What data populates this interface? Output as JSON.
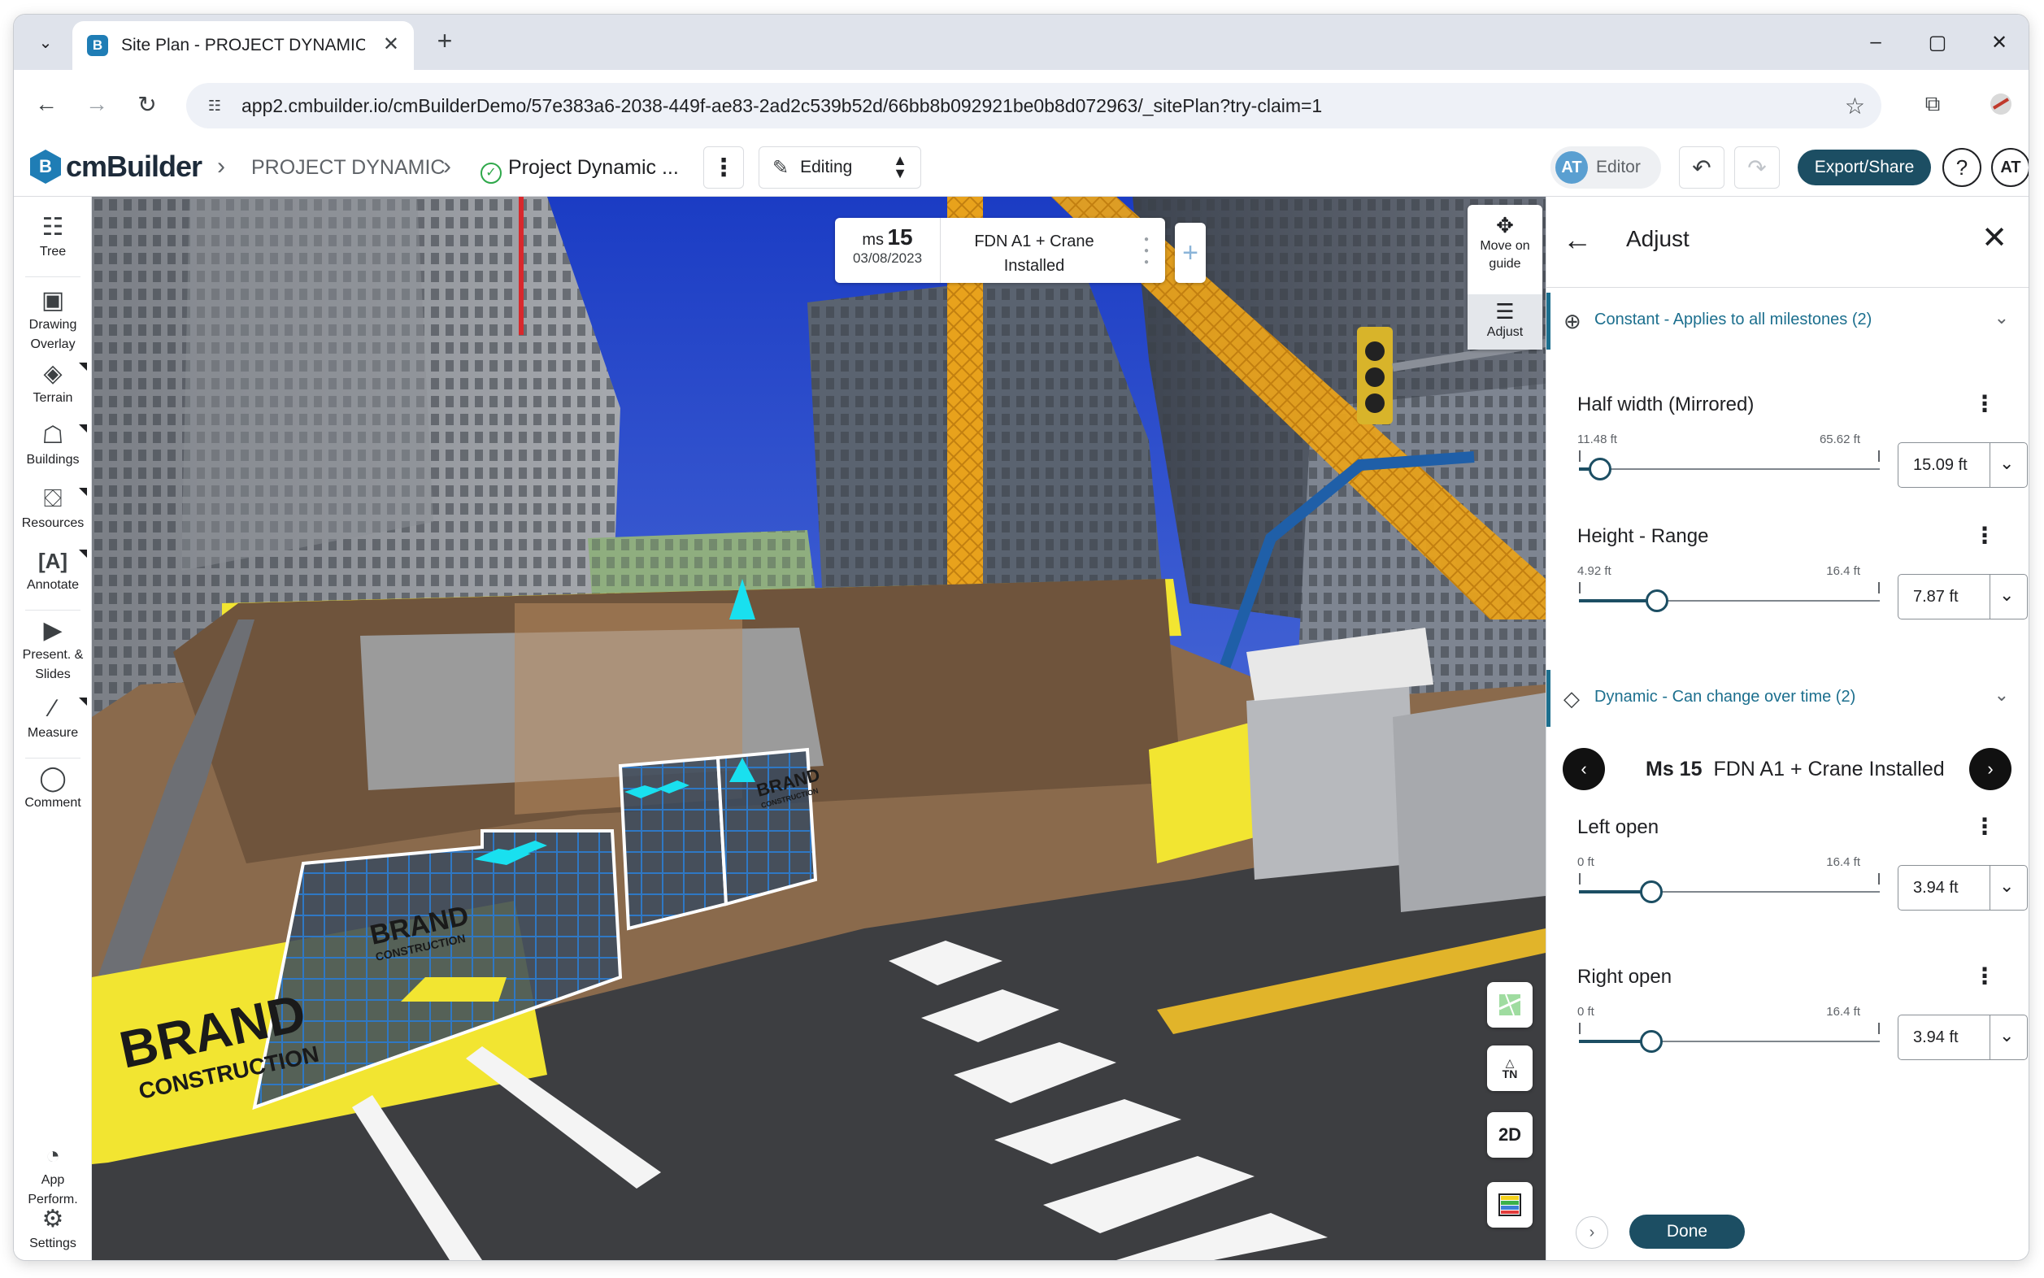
{
  "browser": {
    "tab_title": "Site Plan - PROJECT DYNAMIC",
    "favicon_letter": "B",
    "url": "app2.cmbuilder.io/cmBuilderDemo/57e383a6-2038-449f-ae83-2ad2c539b52d/66bb8b092921be0b8d072963/_sitePlan?try-claim=1"
  },
  "header": {
    "logo_mark": "B",
    "logo_text": "cmBuilder",
    "breadcrumb_project": "PROJECT DYNAMIC",
    "breadcrumb_plan": "Project Dynamic ...",
    "mode": "Editing",
    "role_initials": "AT",
    "role_label": "Editor",
    "export_label": "Export/Share",
    "help_label": "?",
    "user_initials": "AT"
  },
  "left_tools": [
    {
      "label": "Tree",
      "icon": "tree-icon"
    },
    {
      "label": "Drawing Overlay",
      "icon": "image-icon"
    },
    {
      "label": "Terrain",
      "icon": "terrain-icon"
    },
    {
      "label": "Buildings",
      "icon": "building-icon"
    },
    {
      "label": "Resources",
      "icon": "resources-icon"
    },
    {
      "label": "Annotate",
      "icon": "annotate-icon"
    },
    {
      "label": "Present. & Slides",
      "icon": "presentation-icon"
    },
    {
      "label": "Measure",
      "icon": "ruler-icon"
    },
    {
      "label": "Comment",
      "icon": "comment-icon"
    },
    {
      "label": "App Perform.",
      "icon": "performance-icon"
    },
    {
      "label": "Settings",
      "icon": "settings-icon"
    }
  ],
  "milestone_card": {
    "prefix": "ms",
    "number": "15",
    "date": "03/08/2023",
    "name_line1": "FDN A1 + Crane",
    "name_line2": "Installed",
    "add_label": "+"
  },
  "view_tools": {
    "move_label": "Move on guide",
    "adjust_label": "Adjust"
  },
  "map_buttons": {
    "north_label": "TN",
    "view_2d_label": "2D"
  },
  "panel": {
    "title": "Adjust",
    "constant_section": "Constant - Applies to all milestones (2)",
    "dynamic_section": "Dynamic - Can change over time (2)",
    "properties_constant": [
      {
        "label": "Half width (Mirrored)",
        "min": "11.48 ft",
        "max": "65.62 ft",
        "value": "15.09 ft",
        "fraction": 0.07
      },
      {
        "label": "Height - Range",
        "min": "4.92 ft",
        "max": "16.4 ft",
        "value": "7.87 ft",
        "fraction": 0.26
      }
    ],
    "milestone_nav": {
      "prefix": "Ms 15",
      "name": "FDN A1 + Crane Installed"
    },
    "properties_dynamic": [
      {
        "label": "Left open",
        "min": "0 ft",
        "max": "16.4 ft",
        "value": "3.94 ft",
        "fraction": 0.24
      },
      {
        "label": "Right open",
        "min": "0 ft",
        "max": "16.4 ft",
        "value": "3.94 ft",
        "fraction": 0.24
      }
    ],
    "done_label": "Done"
  },
  "scene_text": {
    "billboard_line1": "BRAND",
    "billboard_line2": "CONSTRUCTION",
    "gate_line1": "BRAND",
    "gate_line2": "CONSTRUCTION",
    "sign_line1": "BRAND",
    "sign_line2": "CONSTRUCTION"
  },
  "colors": {
    "brand_blue": "#1f7db5",
    "primary_dark": "#1c4e63",
    "section_accent": "#1c6f8e",
    "hoarding_yellow": "#f2e531",
    "crane_orange": "#e8a21c",
    "gate_blue": "#2f78c4"
  }
}
